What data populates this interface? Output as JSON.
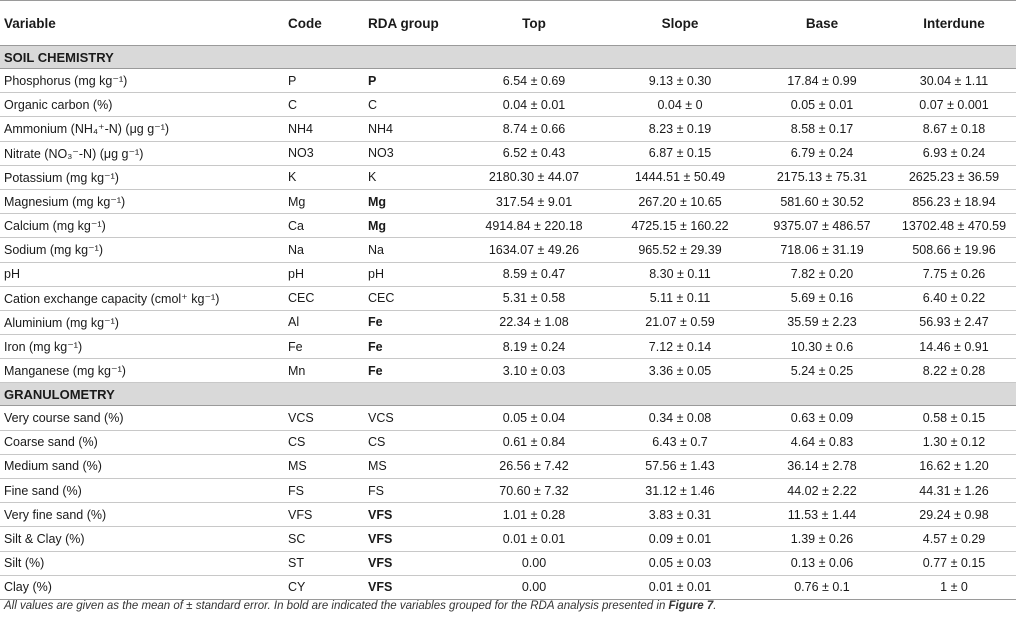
{
  "headers": {
    "variable": "Variable",
    "code": "Code",
    "rda": "RDA group",
    "top": "Top",
    "slope": "Slope",
    "base": "Base",
    "interdune": "Interdune"
  },
  "sections": [
    {
      "title": "SOIL CHEMISTRY",
      "rows": [
        {
          "variable": "Phosphorus (mg kg⁻¹)",
          "code": "P",
          "rda": "P",
          "rda_bold": true,
          "top": "6.54 ± 0.69",
          "slope": "9.13 ± 0.30",
          "base": "17.84 ± 0.99",
          "interdune": "30.04 ± 1.11"
        },
        {
          "variable": "Organic carbon (%)",
          "code": "C",
          "rda": "C",
          "rda_bold": false,
          "top": "0.04 ± 0.01",
          "slope": "0.04 ± 0",
          "base": "0.05 ± 0.01",
          "interdune": "0.07 ± 0.001"
        },
        {
          "variable": "Ammonium (NH₄⁺-N) (μg g⁻¹)",
          "code": "NH4",
          "rda": "NH4",
          "rda_bold": false,
          "top": "8.74 ± 0.66",
          "slope": "8.23 ± 0.19",
          "base": "8.58 ± 0.17",
          "interdune": "8.67 ± 0.18"
        },
        {
          "variable": "Nitrate (NO₃⁻-N) (μg g⁻¹)",
          "code": "NO3",
          "rda": "NO3",
          "rda_bold": false,
          "top": "6.52 ± 0.43",
          "slope": "6.87 ± 0.15",
          "base": "6.79 ± 0.24",
          "interdune": "6.93 ± 0.24"
        },
        {
          "variable": "Potassium (mg kg⁻¹)",
          "code": "K",
          "rda": "K",
          "rda_bold": false,
          "top": "2180.30 ± 44.07",
          "slope": "1444.51 ± 50.49",
          "base": "2175.13 ± 75.31",
          "interdune": "2625.23 ± 36.59"
        },
        {
          "variable": "Magnesium (mg kg⁻¹)",
          "code": "Mg",
          "rda": "Mg",
          "rda_bold": true,
          "top": "317.54 ± 9.01",
          "slope": "267.20 ± 10.65",
          "base": "581.60 ± 30.52",
          "interdune": "856.23 ± 18.94"
        },
        {
          "variable": "Calcium (mg kg⁻¹)",
          "code": "Ca",
          "rda": "Mg",
          "rda_bold": true,
          "top": "4914.84 ± 220.18",
          "slope": "4725.15 ± 160.22",
          "base": "9375.07 ± 486.57",
          "interdune": "13702.48 ± 470.59"
        },
        {
          "variable": "Sodium (mg kg⁻¹)",
          "code": "Na",
          "rda": "Na",
          "rda_bold": false,
          "top": "1634.07 ± 49.26",
          "slope": "965.52 ± 29.39",
          "base": "718.06 ± 31.19",
          "interdune": "508.66 ± 19.96"
        },
        {
          "variable": "pH",
          "code": "pH",
          "rda": "pH",
          "rda_bold": false,
          "top": "8.59 ± 0.47",
          "slope": "8.30 ± 0.11",
          "base": "7.82 ± 0.20",
          "interdune": "7.75 ± 0.26"
        },
        {
          "variable": "Cation exchange capacity (cmol⁺ kg⁻¹)",
          "code": "CEC",
          "rda": "CEC",
          "rda_bold": false,
          "top": "5.31 ± 0.58",
          "slope": "5.11 ± 0.11",
          "base": "5.69 ± 0.16",
          "interdune": "6.40 ± 0.22"
        },
        {
          "variable": "Aluminium (mg kg⁻¹)",
          "code": "Al",
          "rda": "Fe",
          "rda_bold": true,
          "top": "22.34 ± 1.08",
          "slope": "21.07 ± 0.59",
          "base": "35.59 ± 2.23",
          "interdune": "56.93 ± 2.47"
        },
        {
          "variable": "Iron (mg kg⁻¹)",
          "code": "Fe",
          "rda": "Fe",
          "rda_bold": true,
          "top": "8.19 ± 0.24",
          "slope": "7.12 ± 0.14",
          "base": "10.30 ± 0.6",
          "interdune": "14.46 ± 0.91"
        },
        {
          "variable": "Manganese (mg kg⁻¹)",
          "code": "Mn",
          "rda": "Fe",
          "rda_bold": true,
          "top": "3.10 ± 0.03",
          "slope": "3.36 ± 0.05",
          "base": "5.24 ± 0.25",
          "interdune": "8.22 ± 0.28"
        }
      ]
    },
    {
      "title": "GRANULOMETRY",
      "rows": [
        {
          "variable": "Very course sand (%)",
          "code": "VCS",
          "rda": "VCS",
          "rda_bold": false,
          "top": "0.05 ± 0.04",
          "slope": "0.34 ± 0.08",
          "base": "0.63 ± 0.09",
          "interdune": "0.58 ± 0.15"
        },
        {
          "variable": "Coarse sand (%)",
          "code": "CS",
          "rda": "CS",
          "rda_bold": false,
          "top": "0.61 ± 0.84",
          "slope": "6.43 ± 0.7",
          "base": "4.64 ± 0.83",
          "interdune": "1.30 ± 0.12"
        },
        {
          "variable": "Medium sand (%)",
          "code": "MS",
          "rda": "MS",
          "rda_bold": false,
          "top": "26.56 ± 7.42",
          "slope": "57.56 ± 1.43",
          "base": "36.14 ± 2.78",
          "interdune": "16.62 ± 1.20"
        },
        {
          "variable": "Fine sand (%)",
          "code": "FS",
          "rda": "FS",
          "rda_bold": false,
          "top": "70.60 ± 7.32",
          "slope": "31.12 ± 1.46",
          "base": "44.02 ± 2.22",
          "interdune": "44.31 ± 1.26"
        },
        {
          "variable": "Very fine sand (%)",
          "code": "VFS",
          "rda": "VFS",
          "rda_bold": true,
          "top": "1.01 ± 0.28",
          "slope": "3.83 ± 0.31",
          "base": "11.53 ± 1.44",
          "interdune": "29.24 ± 0.98"
        },
        {
          "variable": "Silt & Clay (%)",
          "code": "SC",
          "rda": "VFS",
          "rda_bold": true,
          "top": "0.01 ± 0.01",
          "slope": "0.09 ± 0.01",
          "base": "1.39 ± 0.26",
          "interdune": "4.57 ± 0.29"
        },
        {
          "variable": "Silt (%)",
          "code": "ST",
          "rda": "VFS",
          "rda_bold": true,
          "top": "0.00",
          "slope": "0.05 ± 0.03",
          "base": "0.13 ± 0.06",
          "interdune": "0.77 ± 0.15"
        },
        {
          "variable": "Clay (%)",
          "code": "CY",
          "rda": "VFS",
          "rda_bold": true,
          "top": "0.00",
          "slope": "0.01 ± 0.01",
          "base": "0.76 ± 0.1",
          "interdune": "1 ± 0"
        }
      ]
    }
  ],
  "footnote": {
    "text": "All values are given as the mean of ± standard error. In bold are indicated the variables grouped for the RDA analysis presented in ",
    "ref": "Figure 7",
    "end": "."
  }
}
